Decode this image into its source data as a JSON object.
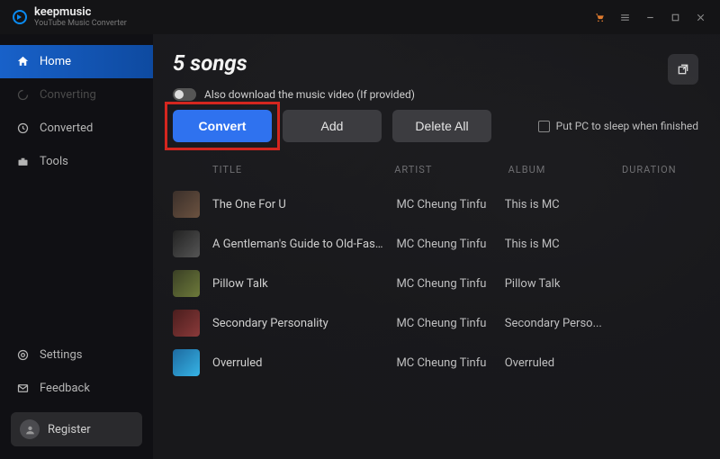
{
  "app": {
    "name": "keepmusic",
    "subtitle": "YouTube Music Converter"
  },
  "titlebar": {
    "cart_icon": "cart-icon",
    "menu_icon": "menu-icon",
    "minimize_icon": "minimize-icon",
    "maximize_icon": "maximize-icon",
    "close_icon": "close-icon"
  },
  "sidebar": {
    "items": [
      {
        "label": "Home",
        "icon": "home-icon"
      },
      {
        "label": "Converting",
        "icon": "spinner-icon"
      },
      {
        "label": "Converted",
        "icon": "clock-icon"
      },
      {
        "label": "Tools",
        "icon": "toolbox-icon"
      }
    ],
    "footer": [
      {
        "label": "Settings",
        "icon": "gear-icon"
      },
      {
        "label": "Feedback",
        "icon": "mail-icon"
      }
    ],
    "register": {
      "label": "Register",
      "icon": "user-icon"
    }
  },
  "main": {
    "headline": "5 songs",
    "download_video_label": "Also download the music video (If provided)",
    "buttons": {
      "convert": "Convert",
      "add": "Add",
      "delete_all": "Delete All"
    },
    "sleep_label": "Put PC to sleep when finished",
    "columns": {
      "title": "TITLE",
      "artist": "ARTIST",
      "album": "ALBUM",
      "duration": "DURATION"
    },
    "tracks": [
      {
        "title": "The One For U",
        "artist": "MC Cheung Tinfu",
        "album": "This is MC",
        "duration": ""
      },
      {
        "title": "A Gentleman's Guide to Old-Fashioned D...",
        "artist": "MC Cheung Tinfu",
        "album": "This is MC",
        "duration": ""
      },
      {
        "title": "Pillow Talk",
        "artist": "MC Cheung Tinfu",
        "album": "Pillow Talk",
        "duration": ""
      },
      {
        "title": "Secondary Personality",
        "artist": "MC Cheung Tinfu",
        "album": "Secondary Perso...",
        "duration": ""
      },
      {
        "title": "Overruled",
        "artist": "MC Cheung Tinfu",
        "album": "Overruled",
        "duration": ""
      }
    ]
  }
}
